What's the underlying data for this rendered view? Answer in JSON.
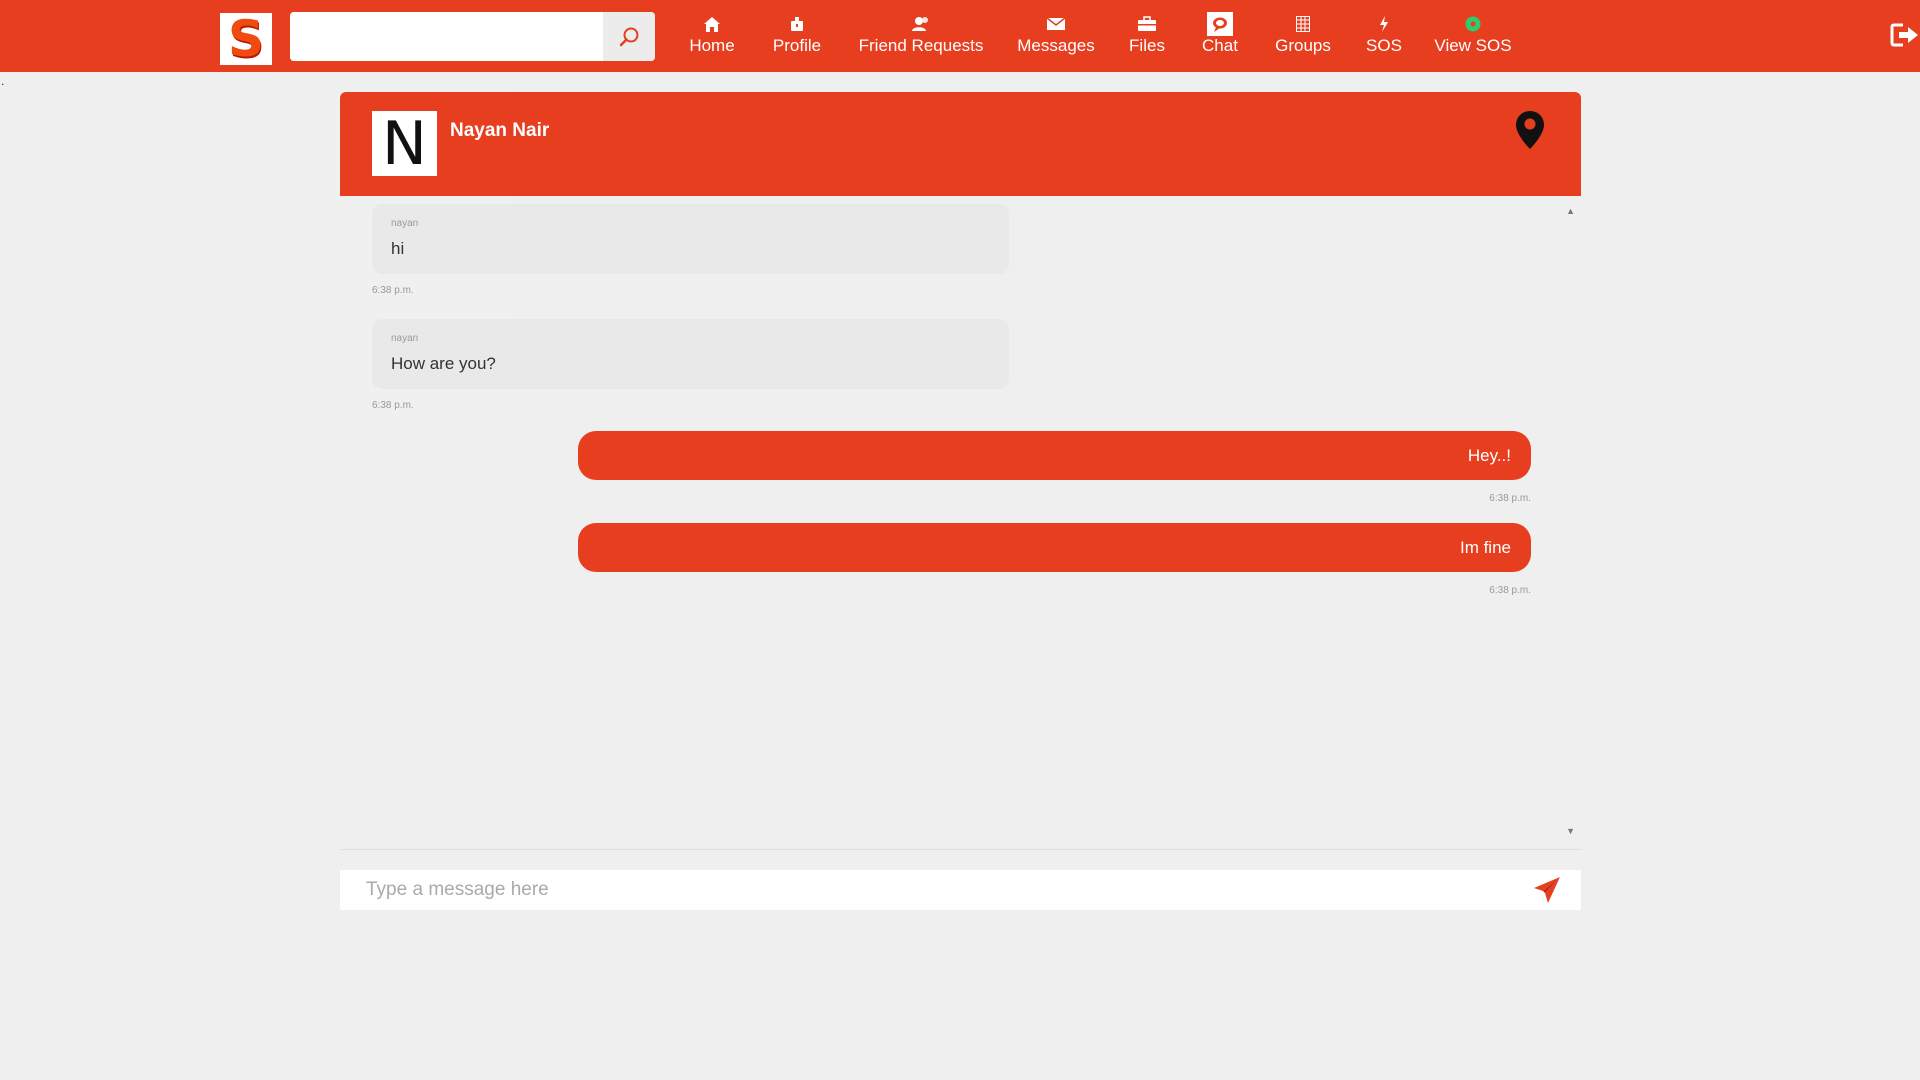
{
  "logo": {
    "letter": "S"
  },
  "search": {
    "placeholder": "",
    "value": ""
  },
  "nav": {
    "items": [
      {
        "label": "Home",
        "icon": "home-icon"
      },
      {
        "label": "Profile",
        "icon": "profile-icon"
      },
      {
        "label": "Friend Requests",
        "icon": "friends-icon"
      },
      {
        "label": "Messages",
        "icon": "envelope-icon"
      },
      {
        "label": "Files",
        "icon": "briefcase-icon"
      },
      {
        "label": "Chat",
        "icon": "chat-icon"
      },
      {
        "label": "Groups",
        "icon": "grid-icon"
      },
      {
        "label": "SOS",
        "icon": "bolt-icon"
      },
      {
        "label": "View SOS",
        "icon": "status-dot-icon"
      }
    ]
  },
  "page_marker": ".",
  "chat": {
    "contact_name": "Nayan Nair",
    "avatar_letter": "N",
    "messages": [
      {
        "direction": "incoming",
        "sender": "nayan",
        "text": "hi",
        "time": "6:38 p.m."
      },
      {
        "direction": "incoming",
        "sender": "nayan",
        "text": "How are you?",
        "time": "6:38 p.m."
      },
      {
        "direction": "outgoing",
        "text": "Hey..!",
        "time": "6:38 p.m."
      },
      {
        "direction": "outgoing",
        "text": "Im fine",
        "time": "6:38 p.m."
      }
    ],
    "composer_placeholder": "Type a message here"
  },
  "colors": {
    "brand": "#e83e20",
    "background": "#f0f0f0",
    "incoming_bubble": "#e9e9e9",
    "status_green": "#2ecc71"
  }
}
